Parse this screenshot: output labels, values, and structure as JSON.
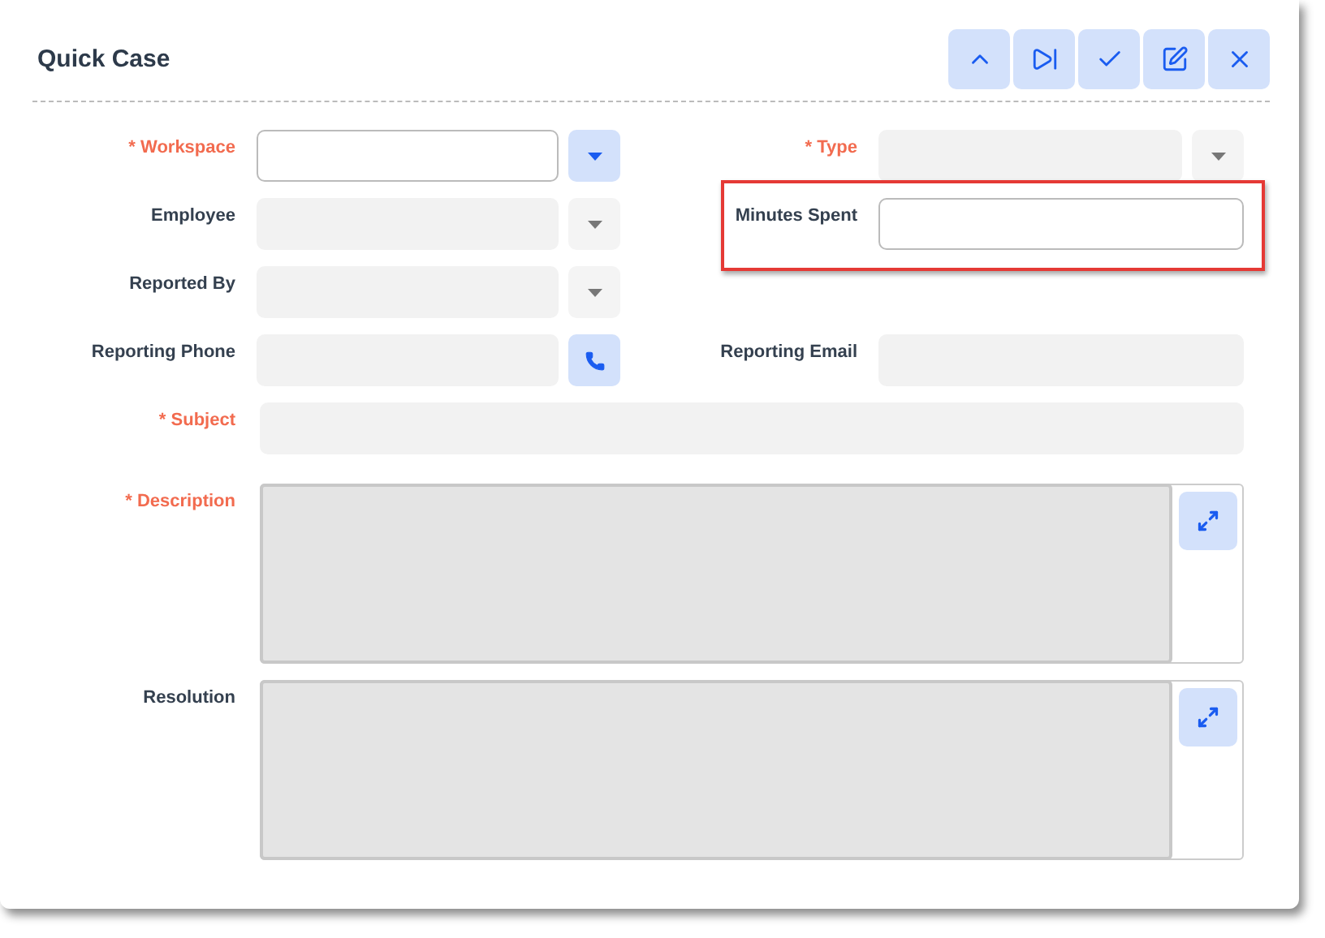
{
  "dialog": {
    "title": "Quick Case"
  },
  "rows": [
    {
      "fields": [
        {
          "label": "* Workspace",
          "required": true,
          "kind": "dropdown",
          "disabled": false,
          "highlighted": false
        },
        {
          "label": "* Type",
          "required": true,
          "kind": "dropdown",
          "disabled": true,
          "highlighted": false
        }
      ]
    },
    {
      "fields": [
        {
          "label": "Employee",
          "required": false,
          "kind": "dropdown",
          "disabled": true,
          "highlighted": false
        },
        {
          "label": "Minutes Spent",
          "required": false,
          "kind": "text",
          "disabled": false,
          "highlighted": true
        }
      ]
    },
    {
      "fields": [
        {
          "label": "Reported By",
          "required": false,
          "kind": "dropdown",
          "disabled": true,
          "highlighted": false
        }
      ]
    },
    {
      "fields": [
        {
          "label": "Reporting Phone",
          "required": false,
          "kind": "phone",
          "disabled": true,
          "highlighted": false
        },
        {
          "label": "Reporting Email",
          "required": false,
          "kind": "text",
          "disabled": true,
          "highlighted": false
        }
      ]
    },
    {
      "fields": [
        {
          "label": "* Subject",
          "required": true,
          "kind": "wide",
          "disabled": true,
          "highlighted": false
        }
      ]
    },
    {
      "fields": [
        {
          "label": "* Description",
          "required": true,
          "kind": "textarea",
          "disabled": true,
          "highlighted": false
        }
      ]
    },
    {
      "fields": [
        {
          "label": "Resolution",
          "required": false,
          "kind": "textarea",
          "disabled": true,
          "highlighted": false
        }
      ]
    }
  ]
}
